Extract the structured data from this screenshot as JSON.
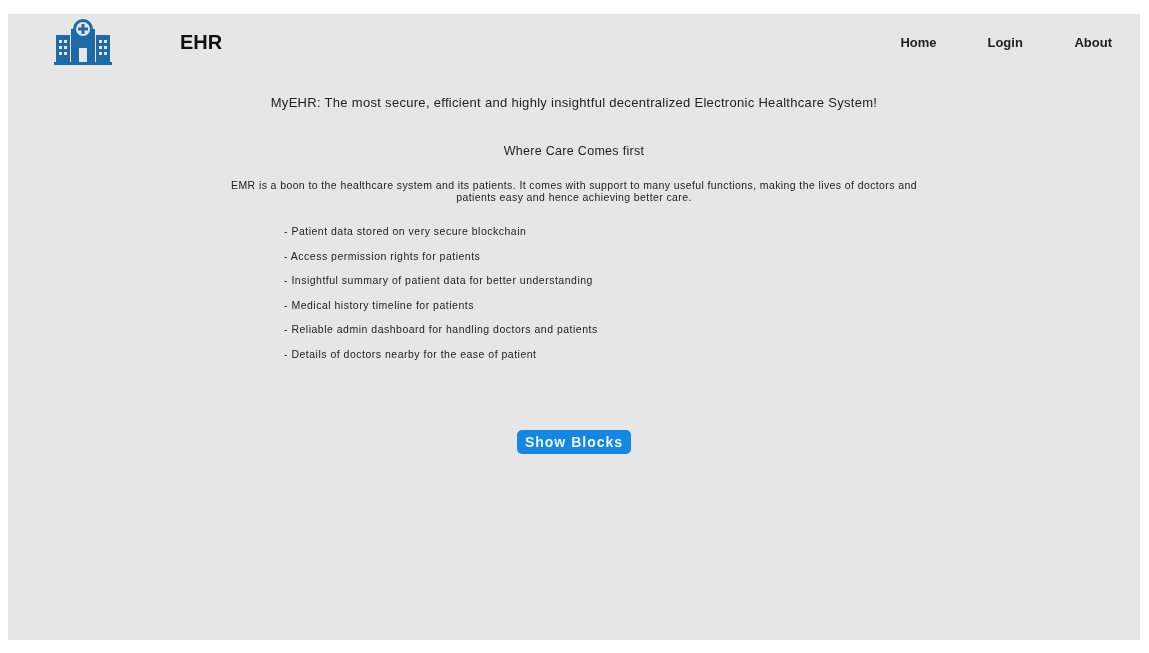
{
  "header": {
    "brand": "EHR",
    "nav": [
      {
        "label": "Home"
      },
      {
        "label": "Login"
      },
      {
        "label": "About"
      }
    ]
  },
  "headline": "MyEHR: The most secure, efficient and highly insightful decentralized Electronic Healthcare System!",
  "tagline": "Where Care Comes first",
  "intro": "EMR is a boon to the healthcare system and its patients. It comes with support to many useful functions, making the lives of doctors and patients easy and hence achieving better care.",
  "features": [
    "- Patient data stored on very secure blockchain",
    "- Access permission rights for patients",
    "- Insightful summary of patient data for better understanding",
    "- Medical history timeline for patients",
    "- Reliable admin dashboard for handling doctors and patients",
    "- Details of doctors nearby for the ease of patient"
  ],
  "button": "Show Blocks"
}
